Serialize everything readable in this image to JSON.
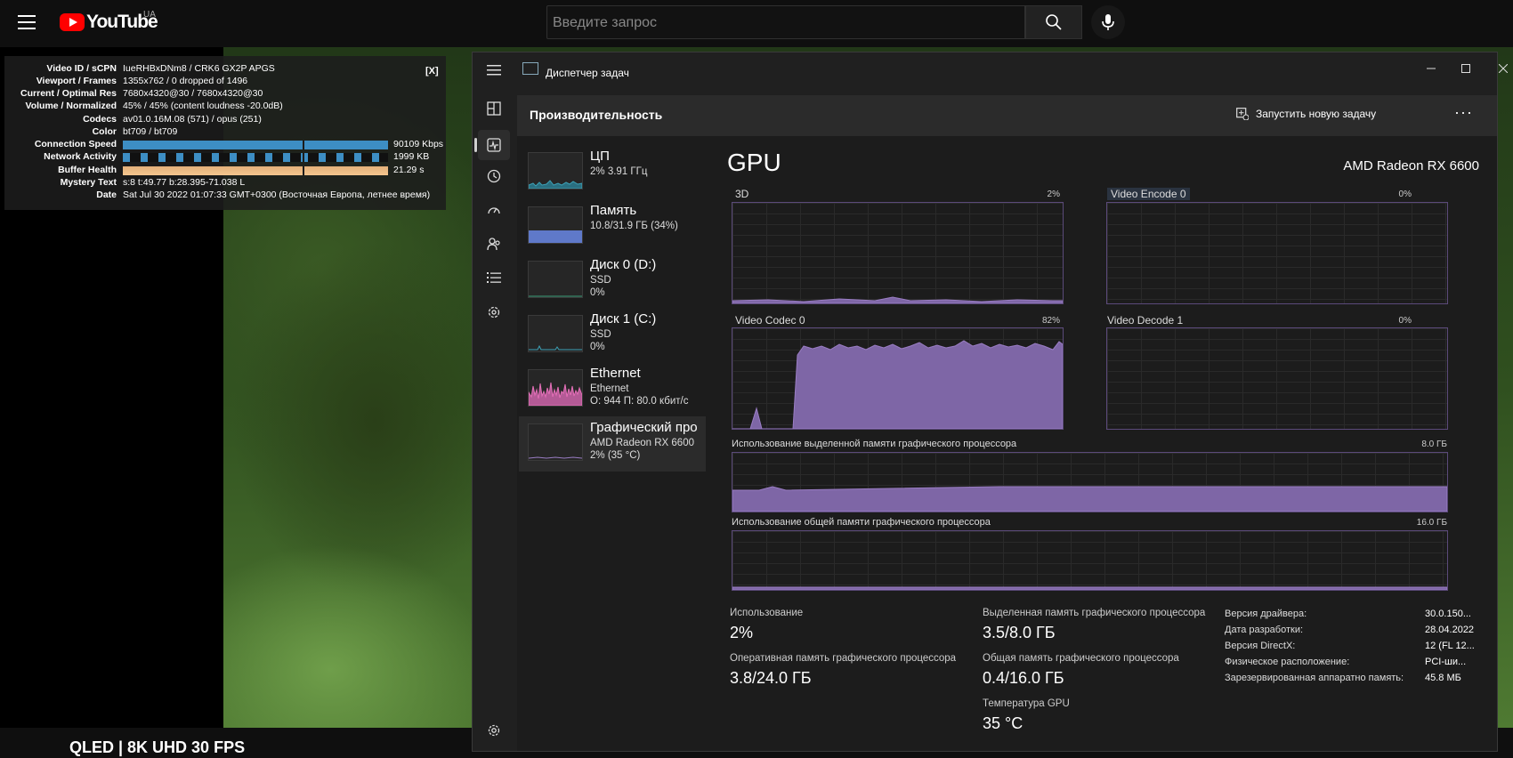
{
  "youtube": {
    "logo_text": "YouTube",
    "region": "UA",
    "search_placeholder": "Введите запрос",
    "video_title": "QLED | 8K UHD 30 FPS"
  },
  "stats": {
    "close_label": "[X]",
    "rows": [
      {
        "k": "Video ID / sCPN",
        "v": "IueRHBxDNm8  /  CRK6  GX2P  APGS"
      },
      {
        "k": "Viewport / Frames",
        "v": "1355x762 / 0 dropped of 1496"
      },
      {
        "k": "Current / Optimal Res",
        "v": "7680x4320@30 / 7680x4320@30"
      },
      {
        "k": "Volume / Normalized",
        "v": "45% / 45% (content loudness -20.0dB)"
      },
      {
        "k": "Codecs",
        "v": "av01.0.16M.08 (571) / opus (251)"
      },
      {
        "k": "Color",
        "v": "bt709 / bt709"
      },
      {
        "k": "Connection Speed",
        "v": "90109 Kbps"
      },
      {
        "k": "Network Activity",
        "v": "1999 KB"
      },
      {
        "k": "Buffer Health",
        "v": "21.29 s"
      },
      {
        "k": "Mystery Text",
        "v": "s:8 t:49.77 b:28.395-71.038 L"
      },
      {
        "k": "Date",
        "v": "Sat Jul 30 2022 01:07:33 GMT+0300 (Восточная Европа, летнее время)"
      }
    ]
  },
  "taskmgr": {
    "title": "Диспетчер задач",
    "section": "Производительность",
    "new_task": "Запустить новую задачу",
    "more": "···",
    "sidebar": [
      {
        "name": "ЦП",
        "s1": "2%  3.91 ГГц",
        "s2": ""
      },
      {
        "name": "Память",
        "s1": "10.8/31.9 ГБ (34%)",
        "s2": ""
      },
      {
        "name": "Диск 0 (D:)",
        "s1": "SSD",
        "s2": "0%"
      },
      {
        "name": "Диск 1 (C:)",
        "s1": "SSD",
        "s2": "0%"
      },
      {
        "name": "Ethernet",
        "s1": "Ethernet",
        "s2": "О: 944  П: 80.0 кбит/с"
      },
      {
        "name": "Графический про",
        "s1": "AMD Radeon RX 6600",
        "s2": "2%  (35 °C)"
      }
    ],
    "gpu_title": "GPU",
    "gpu_model": "AMD Radeon RX 6600",
    "graphs": [
      {
        "label": "3D",
        "pct": "2%"
      },
      {
        "label": "Video Encode 0",
        "pct": "0%"
      },
      {
        "label": "Video Codec 0",
        "pct": "82%"
      },
      {
        "label": "Video Decode 1",
        "pct": "0%"
      }
    ],
    "dedicated_label": "Использование выделенной памяти графического процессора",
    "dedicated_max": "8.0 ГБ",
    "shared_label": "Использование общей памяти графического процессора",
    "shared_max": "16.0 ГБ",
    "stats": {
      "usage_k": "Использование",
      "usage_v": "2%",
      "dedicated_k": "Выделенная память графического процессора",
      "dedicated_v": "3.5/8.0 ГБ",
      "ram_k": "Оперативная память графического процессора",
      "ram_v": "3.8/24.0 ГБ",
      "shared_k": "Общая память графического процессора",
      "shared_v": "0.4/16.0 ГБ",
      "temp_k": "Температура GPU",
      "temp_v": "35 °C"
    },
    "info": [
      {
        "k": "Версия драйвера:",
        "v": "30.0.150..."
      },
      {
        "k": "Дата разработки:",
        "v": "28.04.2022"
      },
      {
        "k": "Версия DirectX:",
        "v": "12 (FL 12..."
      },
      {
        "k": "Физическое расположение:",
        "v": "PCI-ши..."
      },
      {
        "k": "Зарезервированная аппаратно память:",
        "v": "45.8 МБ"
      }
    ]
  },
  "colors": {
    "accent_purple": "#9a7dc4",
    "ethernet_pink": "#e36fb7",
    "cpu_teal": "#3ca0b5",
    "mem_blue": "#5f79c9"
  }
}
